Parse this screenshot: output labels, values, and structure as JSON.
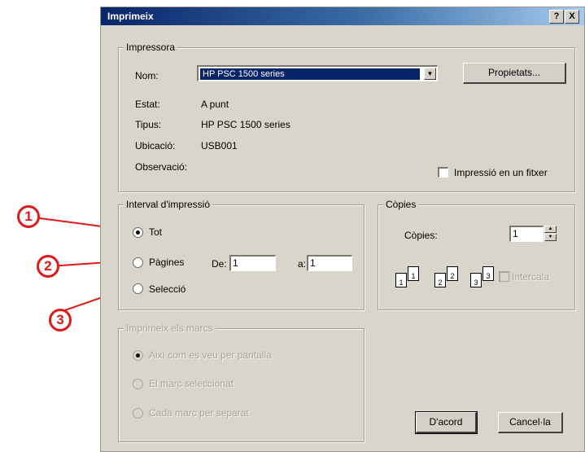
{
  "window": {
    "title": "Imprimeix",
    "help_button": "?",
    "close_button": "X"
  },
  "printer_group": {
    "label": "Impressora",
    "name_label": "Nom:",
    "name_value": "HP PSC 1500 series",
    "properties_button": "Propietats...",
    "status_label": "Estat:",
    "status_value": "A punt",
    "type_label": "Tipus:",
    "type_value": "HP PSC 1500 series",
    "location_label": "Ubicació:",
    "location_value": "USB001",
    "comment_label": "Observació:",
    "print_to_file_label": "Impressió en un fitxer"
  },
  "range_group": {
    "label": "Interval d'impressió",
    "all_label": "Tot",
    "pages_label": "Pàgines",
    "from_label": "De:",
    "from_value": "1",
    "to_label": "a:",
    "to_value": "1",
    "selection_label": "Selecció"
  },
  "copies_group": {
    "label": "Còpies",
    "copies_label": "Còpies:",
    "copies_value": "1",
    "collate_label": "Intercala",
    "page_icons": [
      "1",
      "1",
      "2",
      "2",
      "3",
      "3"
    ]
  },
  "frames_group": {
    "label": "Imprimeix els marcs",
    "option1": "Així com es veu per pantalla",
    "option2": "El marc seleccionat",
    "option3": "Cada marc per separat"
  },
  "buttons": {
    "ok": "D'acord",
    "cancel": "Cancel·la"
  },
  "markers": [
    "1",
    "2",
    "3"
  ],
  "colors": {
    "marker": "#e01818",
    "titlebar": "#0a246a"
  }
}
